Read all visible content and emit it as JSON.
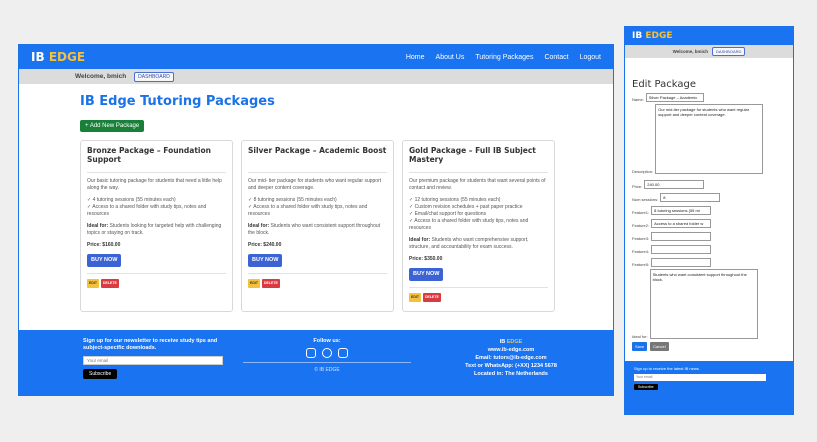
{
  "brand": {
    "name_part1": "IB",
    "name_part2": "EDGE",
    "accent_color": "#f5c13b",
    "primary_color": "#1a73f0"
  },
  "nav": {
    "items": [
      "Home",
      "About Us",
      "Tutoring Packages",
      "Contact",
      "Logout"
    ]
  },
  "welcome": {
    "text": "Welcome, bmich",
    "dashboard_label": "DASHBOARD"
  },
  "main": {
    "title": "IB Edge Tutoring Packages",
    "add_button": "+ Add New Package",
    "cards": [
      {
        "title": "Bronze Package – Foundation Support",
        "description": "Our basic tutoring package for students that need a little help along the way.",
        "features": [
          "✓ 4 tutoring sessions (55 minutes each)",
          "✓ Access to a shared folder with study tips, notes and resources"
        ],
        "ideal_label": "Ideal for:",
        "ideal_text": " Students looking for targeted help with challenging topics or staying on track.",
        "price": "Price: $160.00",
        "buy_label": "BUY NOW",
        "edit_label": "EDIT",
        "delete_label": "DELETE"
      },
      {
        "title": "Silver Package – Academic Boost",
        "description": "Our mid- tier package for students who want regular support and deeper content coverage.",
        "features": [
          "✓ 8 tutoring sessions (55 minutes each)",
          "✓ Access to a shared folder with study tips, notes and resources"
        ],
        "ideal_label": "Ideal for:",
        "ideal_text": " Students who want consistent support throughout the block.",
        "price": "Price: $240.00",
        "buy_label": "BUY NOW",
        "edit_label": "EDIT",
        "delete_label": "DELETE"
      },
      {
        "title": "Gold Package – Full IB Subject Mastery",
        "description": "Our premium package for students that want several points of contact and review.",
        "features": [
          "✓ 12 tutoring sessions (55 minutes each)",
          "✓ Custom revision schedules + past paper practice",
          "✓ Email/chat support for questions",
          "✓ Access to a shared folder with study tips, notes and resources"
        ],
        "ideal_label": "Ideal for:",
        "ideal_text": " Students who want comprehensive support, structure, and accountability for exam success.",
        "price": "Price: $350.00",
        "buy_label": "BUY NOW",
        "edit_label": "EDIT",
        "delete_label": "DELETE"
      }
    ]
  },
  "footer": {
    "newsletter_text": "Sign up for our newsletter to receive study tips and subject-specific downloads.",
    "email_placeholder": "Your email",
    "subscribe_label": "Subscribe",
    "follow_label": "Follow us:",
    "social_icons": [
      "instagram-icon",
      "facebook-icon",
      "youtube-icon"
    ],
    "copyright": "© IB EDGE",
    "contact_brand1": "IB",
    "contact_brand2": "EDGE",
    "website": "www.ib-edge.com",
    "email": "Email: tutors@ib-edge.com",
    "phone": "Text or WhatsApp: (+XX) 1234 5678",
    "location": "Located in: The Netherlands"
  },
  "edit_form": {
    "title": "Edit Package",
    "name_label": "Name:",
    "name_value": "Silver Package – Academic",
    "description_label": "Description:",
    "description_value": "Our mid-tier package for students who want regular support and deeper content coverage.",
    "price_label": "Price:",
    "price_value": "240.00",
    "sessions_label": "Num sessions:",
    "sessions_value": "8",
    "feature1_label": "Feature1:",
    "feature1_value": "8 tutoring sessions (55 mi",
    "feature2_label": "Feature2:",
    "feature2_value": "Access to a shared folder w",
    "feature3_label": "Feature3:",
    "feature3_value": "",
    "feature4_label": "Feature4:",
    "feature4_value": "",
    "feature5_label": "Feature5:",
    "feature5_value": "",
    "ideal_label": "Ideal for:",
    "ideal_value": "Students who want consistent support throughout the block.",
    "save_label": "Save",
    "cancel_label": "Cancel",
    "footer_text": "Sign up to receive the latest IB news.",
    "footer_placeholder": "Your email",
    "footer_subscribe": "Subscribe"
  }
}
